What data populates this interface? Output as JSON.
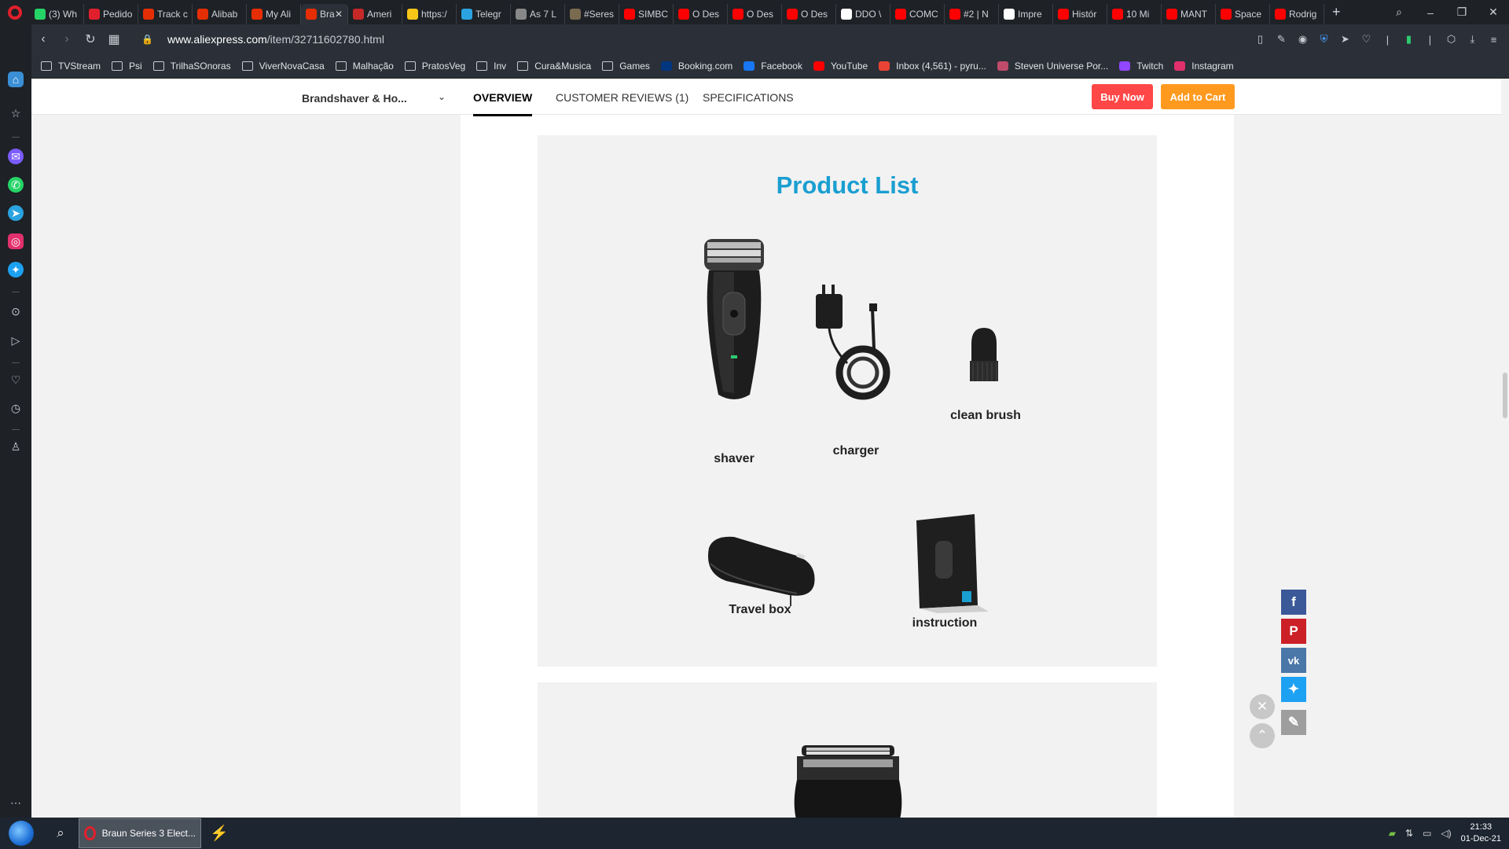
{
  "browser": {
    "tabs": [
      {
        "label": "(3) Wh",
        "color": "#25d366"
      },
      {
        "label": "Pedido",
        "color": "#e0202c"
      },
      {
        "label": "Track c",
        "color": "#e62e04"
      },
      {
        "label": "Alibab",
        "color": "#e62e04"
      },
      {
        "label": "My Ali",
        "color": "#e62e04"
      },
      {
        "label": "Bra",
        "color": "#e62e04",
        "active": true
      },
      {
        "label": "Ameri",
        "color": "#c62828"
      },
      {
        "label": "https:/",
        "color": "#f5c518"
      },
      {
        "label": "Telegr",
        "color": "#2aa3e0"
      },
      {
        "label": "As 7 L",
        "color": "#888888"
      },
      {
        "label": "#Seres",
        "color": "#7a6a50"
      },
      {
        "label": "SIMBC",
        "color": "#ff0000"
      },
      {
        "label": "O Des",
        "color": "#ff0000"
      },
      {
        "label": "O Des",
        "color": "#ff0000"
      },
      {
        "label": "O Des",
        "color": "#ff0000"
      },
      {
        "label": "DDO \\",
        "color": "#ffffff"
      },
      {
        "label": "COMC",
        "color": "#ff0000"
      },
      {
        "label": "#2 | N",
        "color": "#ff0000"
      },
      {
        "label": "Impre",
        "color": "#ffffff"
      },
      {
        "label": "Histór",
        "color": "#ff0000"
      },
      {
        "label": "10 Mi",
        "color": "#ff0000"
      },
      {
        "label": "MANT",
        "color": "#ff0000"
      },
      {
        "label": "Space",
        "color": "#ff0000"
      },
      {
        "label": "Rodrig",
        "color": "#ff0000"
      }
    ],
    "new_tab": "+",
    "url_host": "www.aliexpress.com",
    "url_path": "/item/32711602780.html",
    "bookmarks": [
      {
        "label": "TVStream",
        "type": "folder"
      },
      {
        "label": "Psi",
        "type": "folder"
      },
      {
        "label": "TrilhaSOnoras",
        "type": "folder"
      },
      {
        "label": "ViverNovaCasa",
        "type": "folder"
      },
      {
        "label": "Malhação",
        "type": "folder"
      },
      {
        "label": "PratosVeg",
        "type": "folder"
      },
      {
        "label": "Inv",
        "type": "folder"
      },
      {
        "label": "Cura&Musica",
        "type": "folder"
      },
      {
        "label": "Games",
        "type": "folder"
      },
      {
        "label": "Booking.com",
        "type": "site",
        "color": "#003580"
      },
      {
        "label": "Facebook",
        "type": "site",
        "color": "#1877f2"
      },
      {
        "label": "YouTube",
        "type": "site",
        "color": "#ff0000"
      },
      {
        "label": "Inbox (4,561) - pyru...",
        "type": "site",
        "color": "#ea4335"
      },
      {
        "label": "Steven Universe Por...",
        "type": "site",
        "color": "#c04b6b"
      },
      {
        "label": "Twitch",
        "type": "site",
        "color": "#9146ff"
      },
      {
        "label": "Instagram",
        "type": "site",
        "color": "#e1306c"
      }
    ]
  },
  "store_nav": {
    "store_name": "Brandshaver & Ho...",
    "tabs": [
      {
        "label": "OVERVIEW",
        "active": true
      },
      {
        "label": "CUSTOMER REVIEWS (1)",
        "active": false
      },
      {
        "label": "SPECIFICATIONS",
        "active": false
      }
    ],
    "buy_now": "Buy Now",
    "add_to_cart": "Add to Cart",
    "buy_color": "#ff4747",
    "cart_color": "#ff9a1f"
  },
  "product_list": {
    "title": "Product List",
    "items": [
      {
        "label": "shaver"
      },
      {
        "label": "charger"
      },
      {
        "label": "clean brush"
      },
      {
        "label": "Travel box"
      },
      {
        "label": "instruction"
      }
    ]
  },
  "share_icons": [
    "facebook-icon",
    "pinterest-icon",
    "vk-icon",
    "twitter-icon",
    "pencil-icon"
  ],
  "taskbar": {
    "app_label": "Braun Series 3 Elect...",
    "time": "21:33",
    "date": "01-Dec-21"
  }
}
